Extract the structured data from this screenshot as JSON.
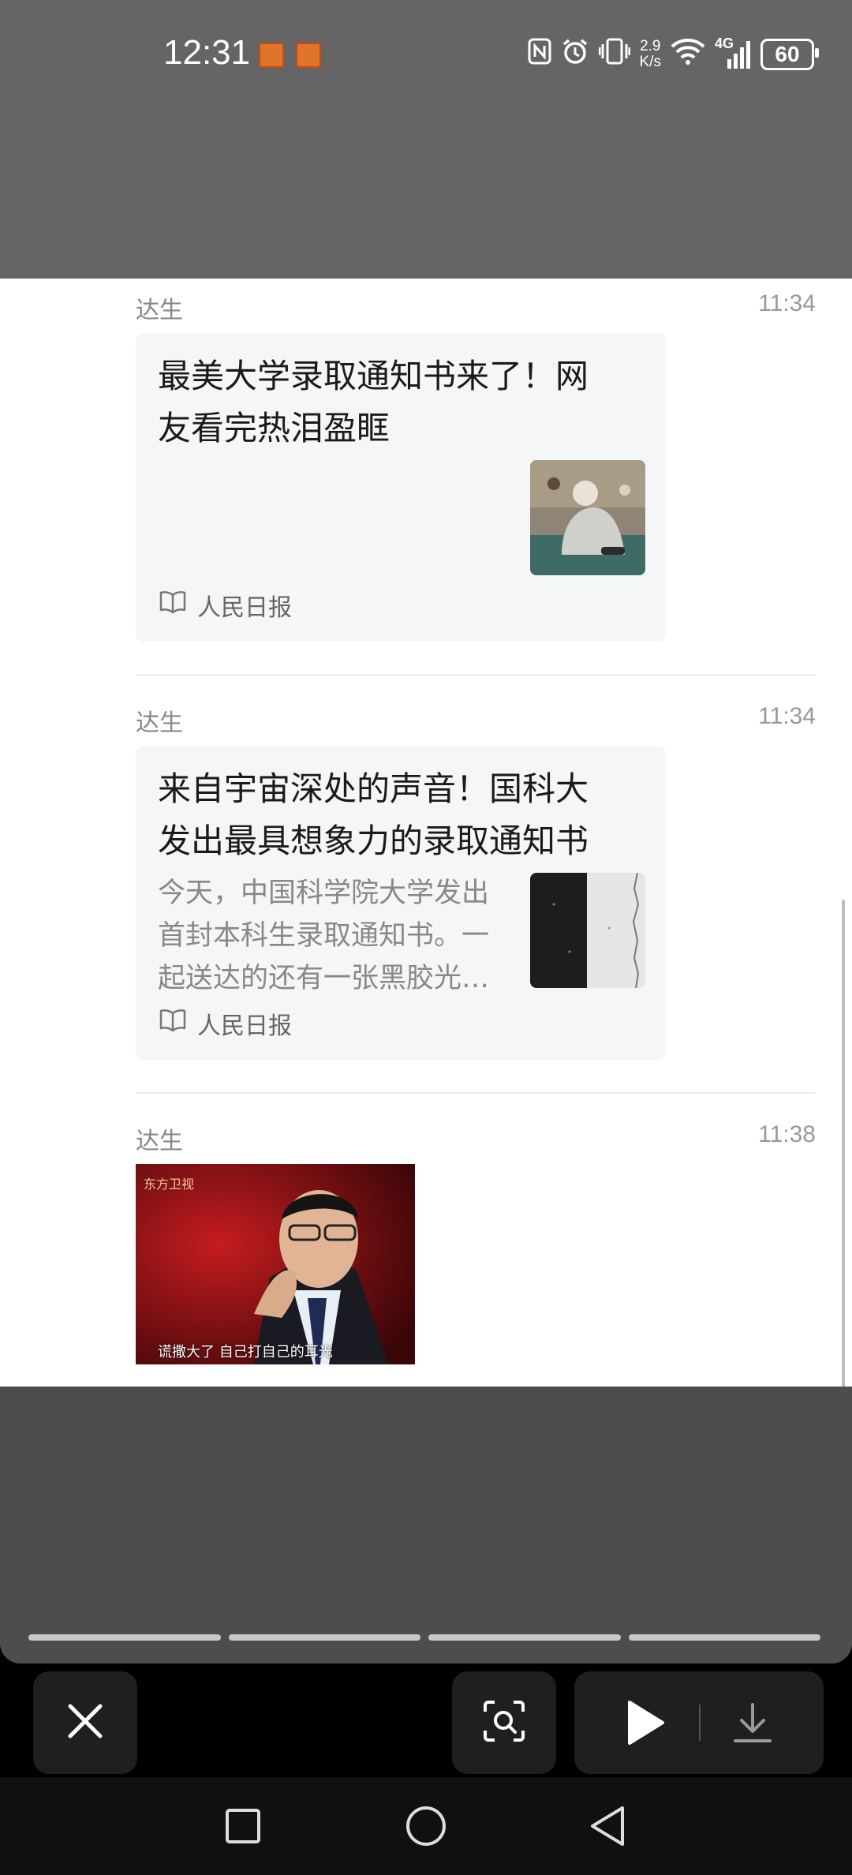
{
  "status_bar": {
    "time": "12:31",
    "net_speed_top": "2.9",
    "net_speed_bottom": "K/s",
    "network_label": "4G",
    "battery": "60",
    "icons": [
      "nfc-icon",
      "alarm-icon",
      "vibrate-icon",
      "wifi-icon",
      "signal-icon",
      "battery-icon"
    ]
  },
  "messages": [
    {
      "sender": "达生",
      "time": "11:34",
      "title": "最美大学录取通知书来了！网友看完热泪盈眶",
      "title_lines": [
        "最美大学录取通知书来了！网",
        "友看完热泪盈眶"
      ],
      "source": "人民日报"
    },
    {
      "sender": "达生",
      "time": "11:34",
      "title_lines": [
        "来自宇宙深处的声音！国科大",
        "发出最具想象力的录取通知书"
      ],
      "desc_lines": [
        "今天，中国科学院大学发出",
        "首封本科生录取通知书。一",
        "起送达的还有一张黑胶光…"
      ],
      "source": "人民日报"
    },
    {
      "sender": "达生",
      "time": "11:38",
      "video_logo": "东方卫视",
      "video_caption": "谎撒大了 自己打自己的耳光"
    }
  ],
  "actions": {
    "close": "close-icon",
    "scan": "scan-icon",
    "play": "play-icon",
    "download": "download-icon"
  },
  "colors": {
    "card_bg": "#f5f6f7",
    "overlay_top": "#656565",
    "overlay_bottom": "#4d4d4d"
  }
}
